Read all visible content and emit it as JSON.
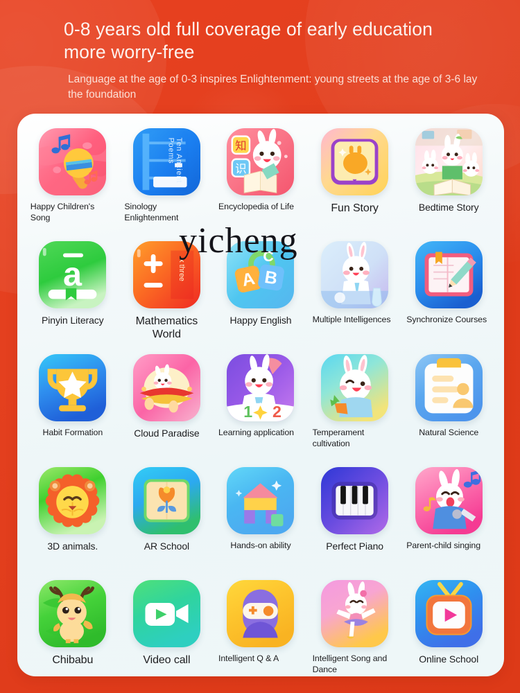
{
  "header": {
    "title": "0-8 years old full coverage of early education more worry-free",
    "subtitle": "Language at the age of 0-3 inspires Enlightenment: young streets at the age of 3-6 lay the foundation"
  },
  "watermark": "yicheng",
  "colors": {
    "background_red": "#e4401f",
    "card_white": "#f1f8f9",
    "label_text": "#1d1d1f",
    "title_text": "#fdf2ee",
    "subtitle_text": "#fbdfd6"
  },
  "apps": [
    {
      "label": "Happy Children's Song",
      "icon": "microphone-music-icon",
      "size": "small"
    },
    {
      "label": "Sinology Enlightenment",
      "icon": "blue-book-icon",
      "size": "small",
      "icon_text": "Ten Ancient Poems"
    },
    {
      "label": "Encyclopedia of Life",
      "icon": "rabbit-open-book-icon",
      "size": "small"
    },
    {
      "label": "Fun Story",
      "icon": "yellow-bunny-book-icon",
      "size": "big"
    },
    {
      "label": "Bedtime Story",
      "icon": "rabbit-family-reading-icon",
      "size": "mid"
    },
    {
      "label": "Pinyin Literacy",
      "icon": "pinyin-a-icon",
      "size": "mid"
    },
    {
      "label": "Mathematics World",
      "icon": "plus-minus-icon",
      "size": "big",
      "icon_text": "x three"
    },
    {
      "label": "Happy English",
      "icon": "abc-blocks-icon",
      "size": "mid"
    },
    {
      "label": "Multiple Intelligences",
      "icon": "rabbit-scientist-icon",
      "size": "small"
    },
    {
      "label": "Synchronize Courses",
      "icon": "notebook-pencil-icon",
      "size": "small"
    },
    {
      "label": "Habit Formation",
      "icon": "trophy-star-icon",
      "size": "small"
    },
    {
      "label": "Cloud Paradise",
      "icon": "rabbit-ufo-icon",
      "size": "mid"
    },
    {
      "label": "Learning application",
      "icon": "rabbit-numbers-icon",
      "size": "small"
    },
    {
      "label": "Temperament cultivation",
      "icon": "rabbit-carrot-icon",
      "size": "small"
    },
    {
      "label": "Natural Science",
      "icon": "clipboard-profile-icon",
      "size": "small"
    },
    {
      "label": "3D animals.",
      "icon": "lion-face-icon",
      "size": "mid"
    },
    {
      "label": "AR School",
      "icon": "flower-book-icon",
      "size": "mid"
    },
    {
      "label": "Hands-on ability",
      "icon": "building-blocks-house-icon",
      "size": "small"
    },
    {
      "label": "Perfect Piano",
      "icon": "piano-keys-icon",
      "size": "mid"
    },
    {
      "label": "Parent-child singing",
      "icon": "rabbit-singing-icon",
      "size": "small"
    },
    {
      "label": "Chibabu",
      "icon": "deer-character-icon",
      "size": "big"
    },
    {
      "label": "Video call",
      "icon": "video-camera-icon",
      "size": "big"
    },
    {
      "label": "Intelligent Q & A",
      "icon": "ninja-goggles-icon",
      "size": "small"
    },
    {
      "label": "Intelligent Song and Dance",
      "icon": "rabbit-ballet-icon",
      "size": "small"
    },
    {
      "label": "Online School",
      "icon": "tv-play-icon",
      "size": "mid"
    }
  ]
}
